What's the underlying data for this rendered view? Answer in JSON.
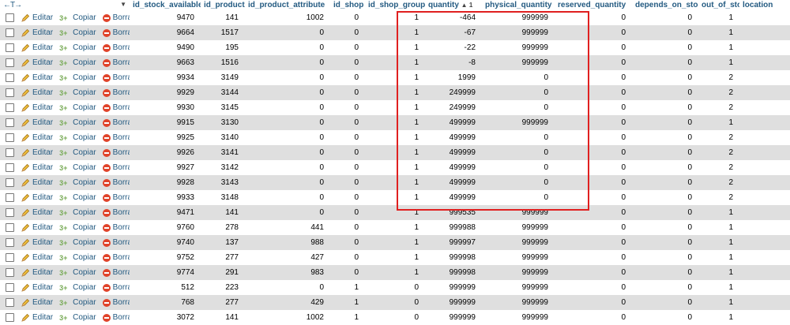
{
  "header": {
    "nav": "←T→",
    "sort_marker": "▼",
    "columns": [
      "id_stock_available",
      "id_product",
      "id_product_attribute",
      "id_shop",
      "id_shop_group",
      "quantity",
      "physical_quantity",
      "reserved_quantity",
      "depends_on_stock",
      "out_of_stock",
      "location"
    ],
    "quantity_sort_suffix": "▲ 1"
  },
  "actions": {
    "edit_label": "Editar",
    "copy_label": "Copiar",
    "delete_label": "Borrar"
  },
  "rows": [
    {
      "id_stock_available": "9470",
      "id_product": "141",
      "id_product_attribute": "1002",
      "id_shop": "0",
      "id_shop_group": "1",
      "quantity": "-464",
      "physical_quantity": "999999",
      "reserved_quantity": "0",
      "depends_on_stock": "0",
      "out_of_stock": "1",
      "location": ""
    },
    {
      "id_stock_available": "9664",
      "id_product": "1517",
      "id_product_attribute": "0",
      "id_shop": "0",
      "id_shop_group": "1",
      "quantity": "-67",
      "physical_quantity": "999999",
      "reserved_quantity": "0",
      "depends_on_stock": "0",
      "out_of_stock": "1",
      "location": ""
    },
    {
      "id_stock_available": "9490",
      "id_product": "195",
      "id_product_attribute": "0",
      "id_shop": "0",
      "id_shop_group": "1",
      "quantity": "-22",
      "physical_quantity": "999999",
      "reserved_quantity": "0",
      "depends_on_stock": "0",
      "out_of_stock": "1",
      "location": ""
    },
    {
      "id_stock_available": "9663",
      "id_product": "1516",
      "id_product_attribute": "0",
      "id_shop": "0",
      "id_shop_group": "1",
      "quantity": "-8",
      "physical_quantity": "999999",
      "reserved_quantity": "0",
      "depends_on_stock": "0",
      "out_of_stock": "1",
      "location": ""
    },
    {
      "id_stock_available": "9934",
      "id_product": "3149",
      "id_product_attribute": "0",
      "id_shop": "0",
      "id_shop_group": "1",
      "quantity": "1999",
      "physical_quantity": "0",
      "reserved_quantity": "0",
      "depends_on_stock": "0",
      "out_of_stock": "2",
      "location": ""
    },
    {
      "id_stock_available": "9929",
      "id_product": "3144",
      "id_product_attribute": "0",
      "id_shop": "0",
      "id_shop_group": "1",
      "quantity": "249999",
      "physical_quantity": "0",
      "reserved_quantity": "0",
      "depends_on_stock": "0",
      "out_of_stock": "2",
      "location": ""
    },
    {
      "id_stock_available": "9930",
      "id_product": "3145",
      "id_product_attribute": "0",
      "id_shop": "0",
      "id_shop_group": "1",
      "quantity": "249999",
      "physical_quantity": "0",
      "reserved_quantity": "0",
      "depends_on_stock": "0",
      "out_of_stock": "2",
      "location": ""
    },
    {
      "id_stock_available": "9915",
      "id_product": "3130",
      "id_product_attribute": "0",
      "id_shop": "0",
      "id_shop_group": "1",
      "quantity": "499999",
      "physical_quantity": "999999",
      "reserved_quantity": "0",
      "depends_on_stock": "0",
      "out_of_stock": "1",
      "location": ""
    },
    {
      "id_stock_available": "9925",
      "id_product": "3140",
      "id_product_attribute": "0",
      "id_shop": "0",
      "id_shop_group": "1",
      "quantity": "499999",
      "physical_quantity": "0",
      "reserved_quantity": "0",
      "depends_on_stock": "0",
      "out_of_stock": "2",
      "location": ""
    },
    {
      "id_stock_available": "9926",
      "id_product": "3141",
      "id_product_attribute": "0",
      "id_shop": "0",
      "id_shop_group": "1",
      "quantity": "499999",
      "physical_quantity": "0",
      "reserved_quantity": "0",
      "depends_on_stock": "0",
      "out_of_stock": "2",
      "location": ""
    },
    {
      "id_stock_available": "9927",
      "id_product": "3142",
      "id_product_attribute": "0",
      "id_shop": "0",
      "id_shop_group": "1",
      "quantity": "499999",
      "physical_quantity": "0",
      "reserved_quantity": "0",
      "depends_on_stock": "0",
      "out_of_stock": "2",
      "location": ""
    },
    {
      "id_stock_available": "9928",
      "id_product": "3143",
      "id_product_attribute": "0",
      "id_shop": "0",
      "id_shop_group": "1",
      "quantity": "499999",
      "physical_quantity": "0",
      "reserved_quantity": "0",
      "depends_on_stock": "0",
      "out_of_stock": "2",
      "location": ""
    },
    {
      "id_stock_available": "9933",
      "id_product": "3148",
      "id_product_attribute": "0",
      "id_shop": "0",
      "id_shop_group": "1",
      "quantity": "499999",
      "physical_quantity": "0",
      "reserved_quantity": "0",
      "depends_on_stock": "0",
      "out_of_stock": "2",
      "location": ""
    },
    {
      "id_stock_available": "9471",
      "id_product": "141",
      "id_product_attribute": "0",
      "id_shop": "0",
      "id_shop_group": "1",
      "quantity": "999535",
      "physical_quantity": "999999",
      "reserved_quantity": "0",
      "depends_on_stock": "0",
      "out_of_stock": "1",
      "location": ""
    },
    {
      "id_stock_available": "9760",
      "id_product": "278",
      "id_product_attribute": "441",
      "id_shop": "0",
      "id_shop_group": "1",
      "quantity": "999988",
      "physical_quantity": "999999",
      "reserved_quantity": "0",
      "depends_on_stock": "0",
      "out_of_stock": "1",
      "location": ""
    },
    {
      "id_stock_available": "9740",
      "id_product": "137",
      "id_product_attribute": "988",
      "id_shop": "0",
      "id_shop_group": "1",
      "quantity": "999997",
      "physical_quantity": "999999",
      "reserved_quantity": "0",
      "depends_on_stock": "0",
      "out_of_stock": "1",
      "location": ""
    },
    {
      "id_stock_available": "9752",
      "id_product": "277",
      "id_product_attribute": "427",
      "id_shop": "0",
      "id_shop_group": "1",
      "quantity": "999998",
      "physical_quantity": "999999",
      "reserved_quantity": "0",
      "depends_on_stock": "0",
      "out_of_stock": "1",
      "location": ""
    },
    {
      "id_stock_available": "9774",
      "id_product": "291",
      "id_product_attribute": "983",
      "id_shop": "0",
      "id_shop_group": "1",
      "quantity": "999998",
      "physical_quantity": "999999",
      "reserved_quantity": "0",
      "depends_on_stock": "0",
      "out_of_stock": "1",
      "location": ""
    },
    {
      "id_stock_available": "512",
      "id_product": "223",
      "id_product_attribute": "0",
      "id_shop": "1",
      "id_shop_group": "0",
      "quantity": "999999",
      "physical_quantity": "999999",
      "reserved_quantity": "0",
      "depends_on_stock": "0",
      "out_of_stock": "1",
      "location": ""
    },
    {
      "id_stock_available": "768",
      "id_product": "277",
      "id_product_attribute": "429",
      "id_shop": "1",
      "id_shop_group": "0",
      "quantity": "999999",
      "physical_quantity": "999999",
      "reserved_quantity": "0",
      "depends_on_stock": "0",
      "out_of_stock": "1",
      "location": ""
    },
    {
      "id_stock_available": "3072",
      "id_product": "141",
      "id_product_attribute": "1002",
      "id_shop": "1",
      "id_shop_group": "0",
      "quantity": "999999",
      "physical_quantity": "999999",
      "reserved_quantity": "0",
      "depends_on_stock": "0",
      "out_of_stock": "1",
      "location": ""
    }
  ],
  "colors": {
    "link": "#235a81",
    "row_alt": "#dfdfdf",
    "highlight_border": "#e02020",
    "delete_icon": "#e0432a"
  }
}
